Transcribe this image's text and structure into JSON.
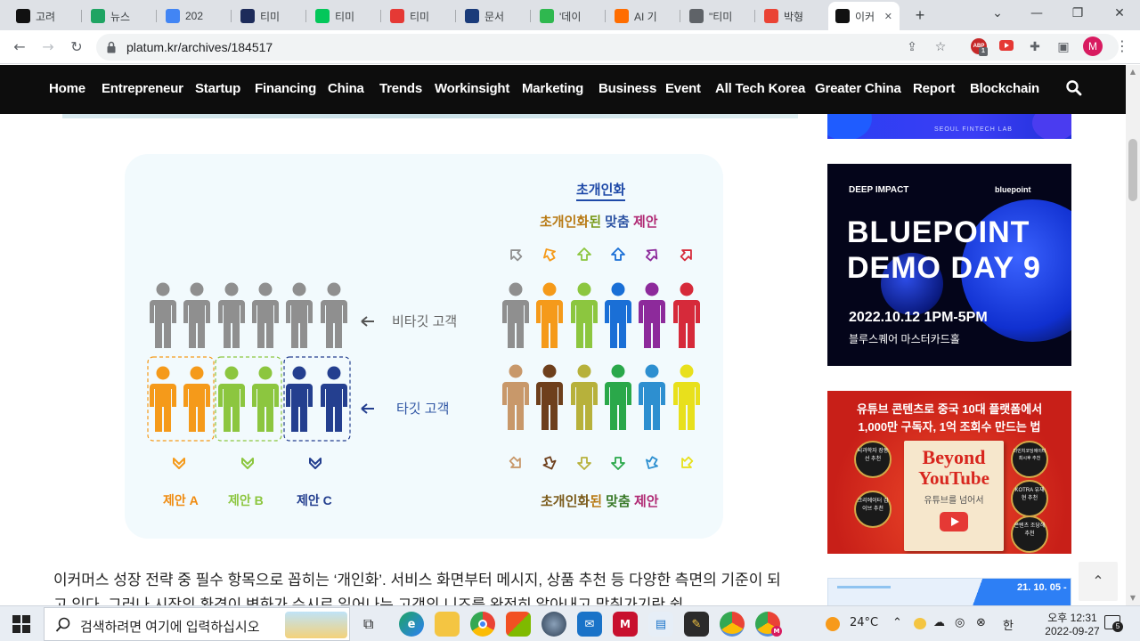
{
  "tabs": [
    {
      "label": "고려",
      "icon": "Bb",
      "color": "#111111"
    },
    {
      "label": "뉴스",
      "icon": "drive",
      "color": "#1fa463"
    },
    {
      "label": "202",
      "icon": "docs",
      "color": "#4285f4"
    },
    {
      "label": "티미",
      "icon": "B",
      "color": "#1d2b5a"
    },
    {
      "label": "티미",
      "icon": "N",
      "color": "#03c75a"
    },
    {
      "label": "티미",
      "icon": "cube",
      "color": "#e53935"
    },
    {
      "label": "문서",
      "icon": "KAIST",
      "color": "#1a3b7a"
    },
    {
      "label": "'데이",
      "icon": "가",
      "color": "#2fb84f"
    },
    {
      "label": "AI 기",
      "icon": "chevron",
      "color": "#ff6d00"
    },
    {
      "label": "\"티미",
      "icon": "globe",
      "color": "#5f6368"
    },
    {
      "label": "박형",
      "icon": "M",
      "color": "#ea4335"
    },
    {
      "label": "이커",
      "icon": "platum",
      "color": "#111111"
    }
  ],
  "window_controls": [
    "⌄",
    "—",
    "❐",
    "✕"
  ],
  "url": "platum.kr/archives/184517",
  "extension_badge": "1",
  "extension_label": "ABP",
  "profile_initial": "M",
  "nav": [
    "Home",
    "Entrepreneur",
    "Startup",
    "Financing",
    "China",
    "Trends",
    "Workinsight",
    "Marketing",
    "Business",
    "Event",
    "All Tech Korea",
    "Greater China",
    "Report",
    "Blockchain"
  ],
  "infographic": {
    "heading": "초개인화",
    "top_caption": {
      "part1": "초개인화",
      "part2": "된 ",
      "part3": "맞춤",
      "part4": " 제안"
    },
    "bottom_caption": {
      "part1": "초개인화",
      "part2": "된 ",
      "part3": "맞춤",
      "part4": " 제안"
    },
    "non_target": "비타깃 고객",
    "target": "타깃 고객",
    "offer_a": "제안 A",
    "offer_b": "제안 B",
    "offer_c": "제안 C",
    "colors": {
      "gray": "#8f8f8f",
      "orange": "#f59a1a",
      "green": "#8cc63f",
      "blue": "#2f55a4",
      "navy": "#243f8f",
      "royal": "#1a6fd6",
      "purple": "#8d2a9b",
      "red": "#d62a3a",
      "tan": "#c8986a",
      "brown": "#6e3f1c",
      "olive": "#b7b13b",
      "kelly": "#2aa84a",
      "sky": "#2d8fd0",
      "yellow": "#e8e01c"
    }
  },
  "article_text": "이커머스 성장 전략 중 필수 항목으로 꼽히는 ‘개인화’. 서비스 화면부터 메시지, 상품 추천 등 다양한 측면의 기준이 되고 있다. 그러나 시장의 환경이 변화가 수시로 일어나는 고객의 니즈를 완전히 알아내고 맞춰가기란 쉽",
  "ads": {
    "top_caption": "SEOUL FINTECH LAB",
    "bluepoint": {
      "tag": "DEEP IMPACT",
      "brand": "bluepoint",
      "line1": "BLUEPOINT",
      "line2": "DEMO DAY 9",
      "date": "2022.10.12 1PM-5PM",
      "venue": "블루스퀘어 마스터카드홀"
    },
    "youtube": {
      "line1": "유튜브 콘텐츠로 중국 10대 플랫폼에서",
      "line2": "1,000만 구독자, 1억 조회수 만드는 법",
      "title1": "Beyond",
      "title2": "YouTube",
      "subtitle": "유튜브를 넘어서",
      "badges": [
        "뇌과학자 장동선 추천",
        "크리에이터 김이브 추천",
        "다빈치코딩에이터 최시후 추천",
        "KOTRA 유재현 추천",
        "콘텐츠 조당해 추천"
      ]
    },
    "bottom_date": "21. 10. 05 -"
  },
  "back_to_top": "⌃",
  "taskbar": {
    "search_placeholder": "검색하려면 여기에 입력하십시오",
    "task_view": "⧉",
    "weather": "24°C",
    "ime": "한",
    "time": "오후 12:31",
    "date": "2022-09-27",
    "notification_count": "5"
  }
}
